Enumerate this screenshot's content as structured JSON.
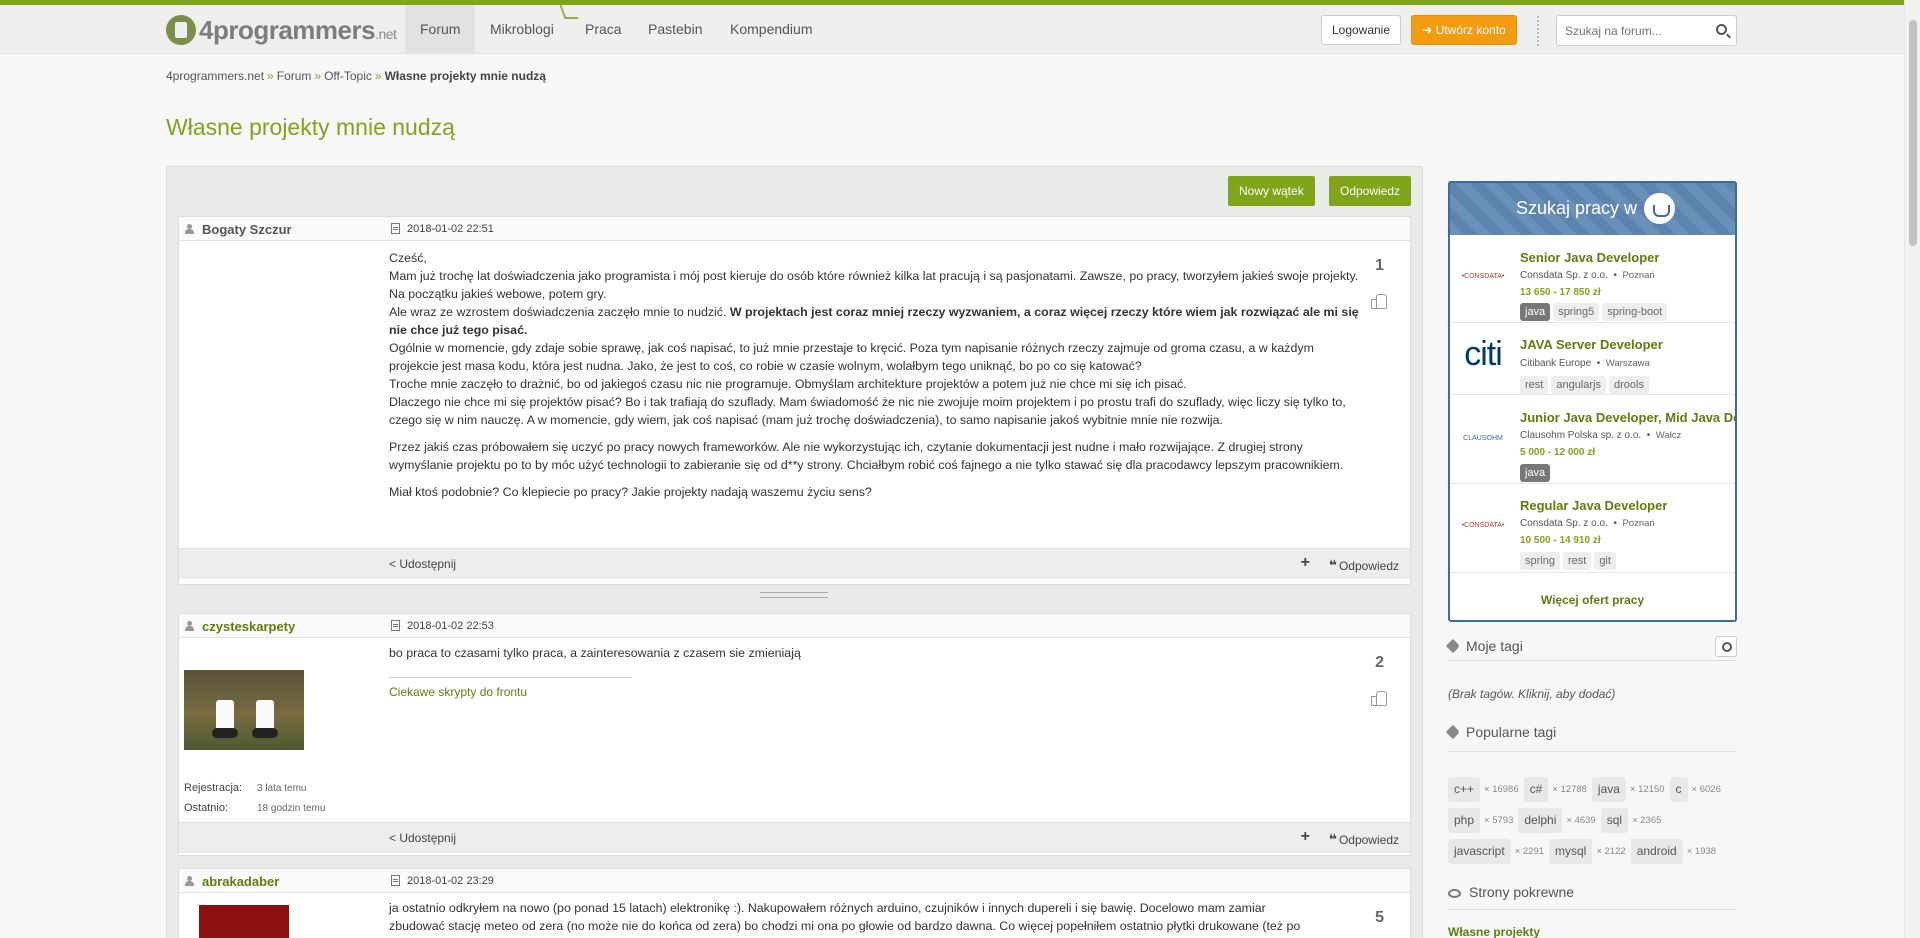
{
  "navbar": {
    "logo_main": "4programmers",
    "logo_suffix": ".net",
    "items": [
      {
        "label": "Forum"
      },
      {
        "label": "Mikroblogi"
      },
      {
        "label": "Praca"
      },
      {
        "label": "Pastebin"
      },
      {
        "label": "Kompendium"
      }
    ],
    "login": "Logowanie",
    "register": "Utwórz konto",
    "search_placeholder": "Szukaj na forum..."
  },
  "breadcrumb": [
    "4programmers.net",
    "Forum",
    "Off-Topic",
    "Własne projekty mnie nudzą"
  ],
  "page_title": "Własne projekty mnie nudzą",
  "toolbar": {
    "new_thread": "Nowy wątek",
    "reply": "Odpowiedz"
  },
  "posts": [
    {
      "user": "Bogaty Szczur",
      "date": "2018-01-02 22:51",
      "number": "1",
      "p1_lines": [
        "Cześć,",
        "Mam już trochę lat doświadczenia jako programista i mój post kieruje do osób które również kilka lat pracują i są pasjonatami. Zawsze, po pracy, tworzyłem jakieś swoje projekty. Na początku jakieś webowe, potem gry."
      ],
      "p1_a": "Ale wraz ze wzrostem doświadczenia zaczęło mnie to nudzić. ",
      "p1_bold": "W projektach jest coraz mniej rzeczy wyzwaniem, a coraz więcej rzeczy które wiem jak rozwiązać ale mi się nie chce już tego pisać.",
      "p1_rest": [
        "Ogólnie w momencie, gdy zdaje sobie sprawę, jak coś napisać, to już mnie przestaje to kręcić. Poza tym napisanie różnych rzeczy zajmuje od groma czasu, a w każdym projekcie jest masa kodu, która jest nudna. Jako, że jest to coś, co robie w czasie wolnym, wolałbym tego uniknąć, bo po co się katować?",
        "Troche mnie zaczęło to drażnić, bo od jakiegoś czasu nic nie programuje. Obmyślam architekture projektów a potem już nie chce mi się ich pisać.",
        "Dlaczego nie chce mi się projektów pisać? Bo i tak trafiają do szuflady. Mam świadomość że nic nie zwojuje moim projektem i po prostu trafi do szuflady, więc liczy się tylko to, czego się w nim nauczę. A w momencie, gdy wiem, jak coś napisać (mam już trochę doświadczenia), to samo napisanie jakoś wybitnie mnie nie rozwija."
      ],
      "p2": "Przez jakiś czas próbowałem się uczyć po pracy nowych frameworków. Ale nie wykorzystując ich, czytanie dokumentacji jest nudne i mało rozwijające. Z drugiej strony wymyślanie projektu po to by móc użyć technologii to zabieranie się od d**y strony. Chciałbym robić coś fajnego a nie tylko stawać się dla pracodawcy lepszym pracownikiem.",
      "p3": "Miał ktoś podobnie? Co klepiecie po pracy? Jakie projekty nadają waszemu życiu sens?"
    },
    {
      "user": "czysteskarpety",
      "date": "2018-01-02 22:53",
      "number": "2",
      "text": "bo praca to czasami tylko praca, a zainteresowania z czasem sie zmieniają",
      "signature": "Ciekawe skrypty do frontu",
      "reg_label": "Rejestracja:",
      "reg_value": "3 lata temu",
      "last_label": "Ostatnio:",
      "last_value": "18 godzin temu"
    },
    {
      "user": "abrakadaber",
      "date": "2018-01-02 23:29",
      "number": "5",
      "line1": "ja ostatnio odkryłem na nowo (po ponad 15 latach) elektronikę :). Nakupowałem różnych arduino, czujników i innych dupereli i się bawię. Docelowo mam zamiar",
      "line2": "zbudować stację meteo od zera (no może nie do końca od zera) bo chodzi mi ona po głowie od bardzo dawna. Co więcej popełniłem ostatnio płytki drukowane (też po"
    }
  ],
  "post_actions": {
    "share": "Udostępnij",
    "reply": "Odpowiedz",
    "plus": "+",
    "quote": "❝"
  },
  "jobs": {
    "header": "Szukaj pracy w",
    "items": [
      {
        "title": "Senior Java Developer",
        "company": "Consdata Sp. z o.o.",
        "location": "Poznań",
        "salary": "13 650 - 17 850 zł",
        "tags": [
          "java",
          "spring5",
          "spring-boot"
        ],
        "logo": "•CONSDATA•"
      },
      {
        "title": "JAVA Server Developer",
        "company": "Citibank Europe",
        "location": "Warszawa",
        "salary": "",
        "tags": [
          "rest",
          "angularjs",
          "drools"
        ],
        "logo": "citi"
      },
      {
        "title": "Junior Java Developer, Mid Java Developer",
        "company": "Clausohm Polska sp. z o.o.",
        "location": "Wałcz",
        "salary": "5 000 - 12 000 zł",
        "tags": [
          "java"
        ],
        "logo": "CLAUSOHM"
      },
      {
        "title": "Regular Java Developer",
        "company": "Consdata Sp. z o.o.",
        "location": "Poznań",
        "salary": "10 500 - 14 910 zł",
        "tags": [
          "spring",
          "rest",
          "git"
        ],
        "logo": "•CONSDATA•"
      }
    ],
    "more": "Więcej ofert pracy"
  },
  "sidebar": {
    "my_tags": "Moje tagi",
    "no_tags": "(Brak tagów. Kliknij, aby dodać)",
    "popular_tags": "Popularne tagi",
    "popular": [
      [
        {
          "tag": "c++",
          "count": "× 16986"
        },
        {
          "tag": "c#",
          "count": "× 12788"
        },
        {
          "tag": "java",
          "count": "× 12150"
        },
        {
          "tag": "c",
          "count": "× 6026"
        }
      ],
      [
        {
          "tag": "php",
          "count": "× 5793"
        },
        {
          "tag": "delphi",
          "count": "× 4639"
        },
        {
          "tag": "sql",
          "count": "× 2365"
        }
      ],
      [
        {
          "tag": "javascript",
          "count": "× 2291"
        },
        {
          "tag": "mysql",
          "count": "× 2122"
        },
        {
          "tag": "android",
          "count": "× 1938"
        }
      ]
    ],
    "related": "Strony pokrewne",
    "related_link": "Własne projekty"
  },
  "colors": {
    "accent": "#80a41a",
    "orange": "#f39c12",
    "jobs_blue": "#3b6c9b"
  }
}
